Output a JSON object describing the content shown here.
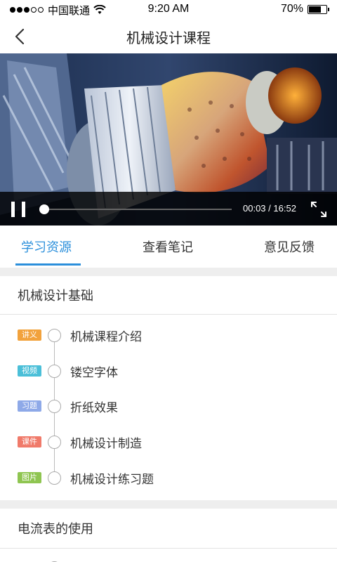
{
  "status_bar": {
    "carrier": "中国联通",
    "time": "9:20 AM",
    "battery_percent": "70%",
    "battery_level": 0.7,
    "signal_icon": "signal-dots-icon",
    "wifi_icon": "wifi-icon"
  },
  "nav": {
    "title": "机械设计课程",
    "back_icon": "back-chevron-icon"
  },
  "video": {
    "current_time": "00:03",
    "separator": "/",
    "duration": "16:52",
    "progress": 0.003,
    "pause_icon": "pause-icon",
    "fullscreen_icon": "fullscreen-icon"
  },
  "tabs": [
    {
      "label": "学习资源",
      "active": true
    },
    {
      "label": "查看笔记",
      "active": false
    },
    {
      "label": "意见反馈",
      "active": false
    }
  ],
  "colors": {
    "accent": "#2b8fdb",
    "badge_lecture": "#f2a23c",
    "badge_video": "#4bbfd8",
    "badge_exercise": "#8ea9e8",
    "badge_courseware": "#f07a6a",
    "badge_image": "#8fc551"
  },
  "sections": [
    {
      "title": "机械设计基础",
      "lessons": [
        {
          "badge": "讲义",
          "title": "机械课程介绍"
        },
        {
          "badge": "视频",
          "title": "镂空字体"
        },
        {
          "badge": "习题",
          "title": "折纸效果"
        },
        {
          "badge": "课件",
          "title": "机械设计制造"
        },
        {
          "badge": "图片",
          "title": "机械设计练习题"
        }
      ]
    },
    {
      "title": "电流表的使用"
    }
  ]
}
